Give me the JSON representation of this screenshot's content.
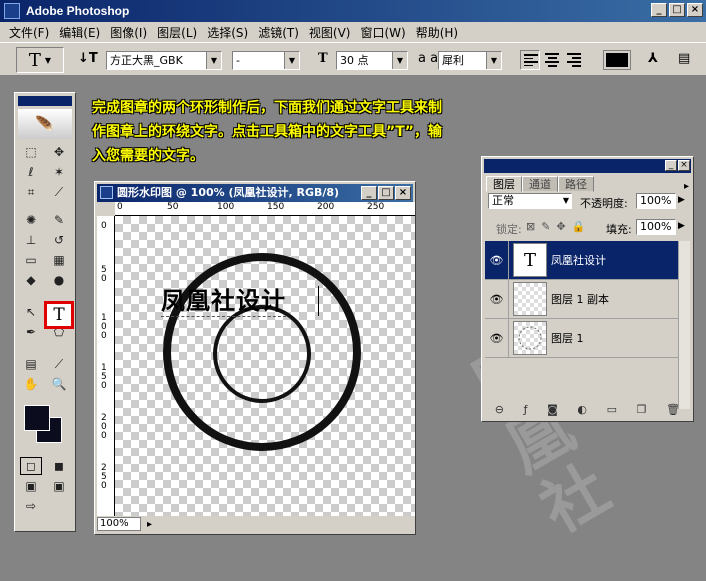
{
  "app": {
    "title": "Adobe Photoshop"
  },
  "menu": [
    "文件(F)",
    "编辑(E)",
    "图像(I)",
    "图层(L)",
    "选择(S)",
    "滤镜(T)",
    "视图(V)",
    "窗口(W)",
    "帮助(H)"
  ],
  "options": {
    "tool_glyph": "T",
    "font_family": "方正大黑_GBK",
    "font_style": "-",
    "font_size": "30 点",
    "antialias": "犀利",
    "aa_label": "a a"
  },
  "caption": "完成图章的两个环形制作后，下面我们通过文字工具来制作图章上的环绕文字。点击工具箱中的文字工具”T”，输入您需要的文字。",
  "document": {
    "title": "圆形水印图 @ 100% (凤凰社设计, RGB/8)",
    "zoom": "100%",
    "canvas_text": "凤凰社设计",
    "ruler_h": [
      "0",
      "50",
      "100",
      "150",
      "200",
      "250"
    ],
    "ruler_v": [
      "0",
      "5\n0",
      "1\n0\n0",
      "1\n5\n0",
      "2\n0\n0",
      "2\n5\n0"
    ]
  },
  "layers_panel": {
    "tabs": [
      "图层",
      "通道",
      "路径"
    ],
    "blend_mode": "正常",
    "opacity_label": "不透明度:",
    "opacity": "100%",
    "lock_label": "锁定:",
    "fill_label": "填充:",
    "fill": "100%",
    "layers": [
      {
        "name": "凤凰社设计",
        "thumb": "T",
        "selected": true
      },
      {
        "name": "图层 1 副本",
        "thumb": "",
        "selected": false
      },
      {
        "name": "图层 1",
        "thumb": "",
        "selected": false
      }
    ]
  },
  "colors": {
    "title_bar": "#0a246a",
    "caption": "#ffff00",
    "highlight": "#e00000",
    "foreground": "#0b0d1e"
  }
}
